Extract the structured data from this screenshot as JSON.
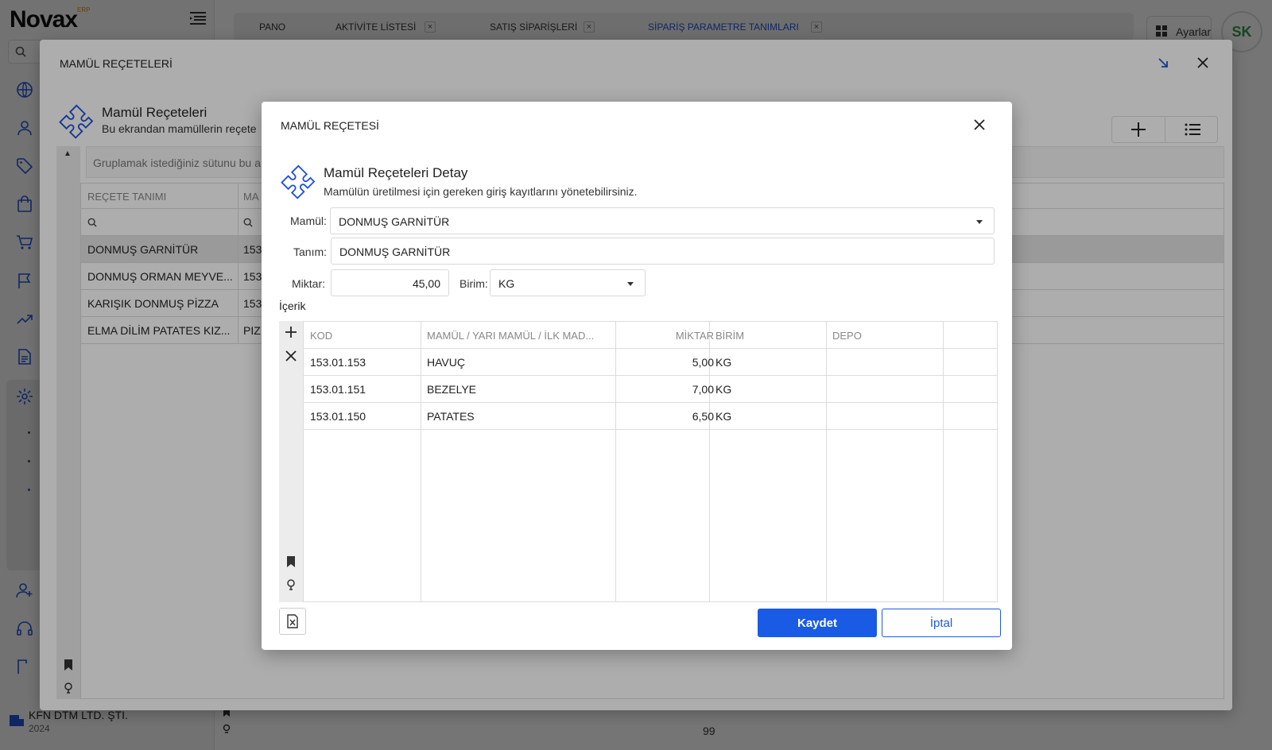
{
  "app": {
    "logo": "Novax",
    "logo_sub": "ERP",
    "company_name": "KFN DTM LTD. ŞTİ.",
    "company_year": "2024",
    "settings_label": "Ayarlar",
    "avatar_initials": "SK",
    "bottom_number": "99"
  },
  "tabs": [
    {
      "label": "PANO",
      "closable": false
    },
    {
      "label": "AKTİVİTE LİSTESİ",
      "closable": true
    },
    {
      "label": "SATIŞ SİPARİŞLERİ",
      "closable": true
    },
    {
      "label": "SİPARİŞ PARAMETRE TANIMLARI",
      "closable": true,
      "active": true
    }
  ],
  "outer_dialog": {
    "title": "MAMÜL REÇETELERİ",
    "header_title": "Mamül Reçeteleri",
    "header_subtitle": "Bu ekrandan mamüllerin reçete",
    "group_hint": "Gruplamak istediğiniz sütunu bu a",
    "columns": [
      "REÇETE TANIMI",
      "MA"
    ],
    "rows": [
      {
        "name": "DONMUŞ GARNİTÜR",
        "code": "153",
        "selected": true
      },
      {
        "name": "DONMUŞ ORMAN MEYVE...",
        "code": "153"
      },
      {
        "name": "KARIŞIK DONMUŞ PİZZA",
        "code": "153"
      },
      {
        "name": "ELMA DİLİM PATATES KIZ...",
        "code": "PIZ"
      }
    ]
  },
  "inner_dialog": {
    "title": "MAMÜL REÇETESİ",
    "header_title": "Mamül Reçeteleri Detay",
    "header_subtitle": "Mamülün üretilmesi için gereken giriş kayıtlarını yönetebilirsiniz.",
    "form": {
      "mamul_label": "Mamül:",
      "mamul_value": "DONMUŞ GARNİTÜR",
      "tanim_label": "Tanım:",
      "tanim_value": "DONMUŞ GARNİTÜR",
      "miktar_label": "Miktar:",
      "miktar_value": "45,00",
      "birim_label": "Birim:",
      "birim_value": "KG"
    },
    "content_label": "İçerik",
    "columns": [
      "KOD",
      "MAMÜL / YARI MAMÜL / İLK MAD...",
      "MİKTAR",
      "BİRİM",
      "DEPO"
    ],
    "rows": [
      {
        "kod": "153.01.153",
        "mamul": "HAVUÇ",
        "miktar": "5,00",
        "birim": "KG",
        "depo": ""
      },
      {
        "kod": "153.01.151",
        "mamul": "BEZELYE",
        "miktar": "7,00",
        "birim": "KG",
        "depo": ""
      },
      {
        "kod": "153.01.150",
        "mamul": "PATATES",
        "miktar": "6,50",
        "birim": "KG",
        "depo": ""
      }
    ],
    "save_label": "Kaydet",
    "cancel_label": "İptal"
  },
  "colors": {
    "accent": "#1a5be6",
    "avatar_text": "#2e9b4a",
    "icon_blue": "#1e4fd6"
  }
}
